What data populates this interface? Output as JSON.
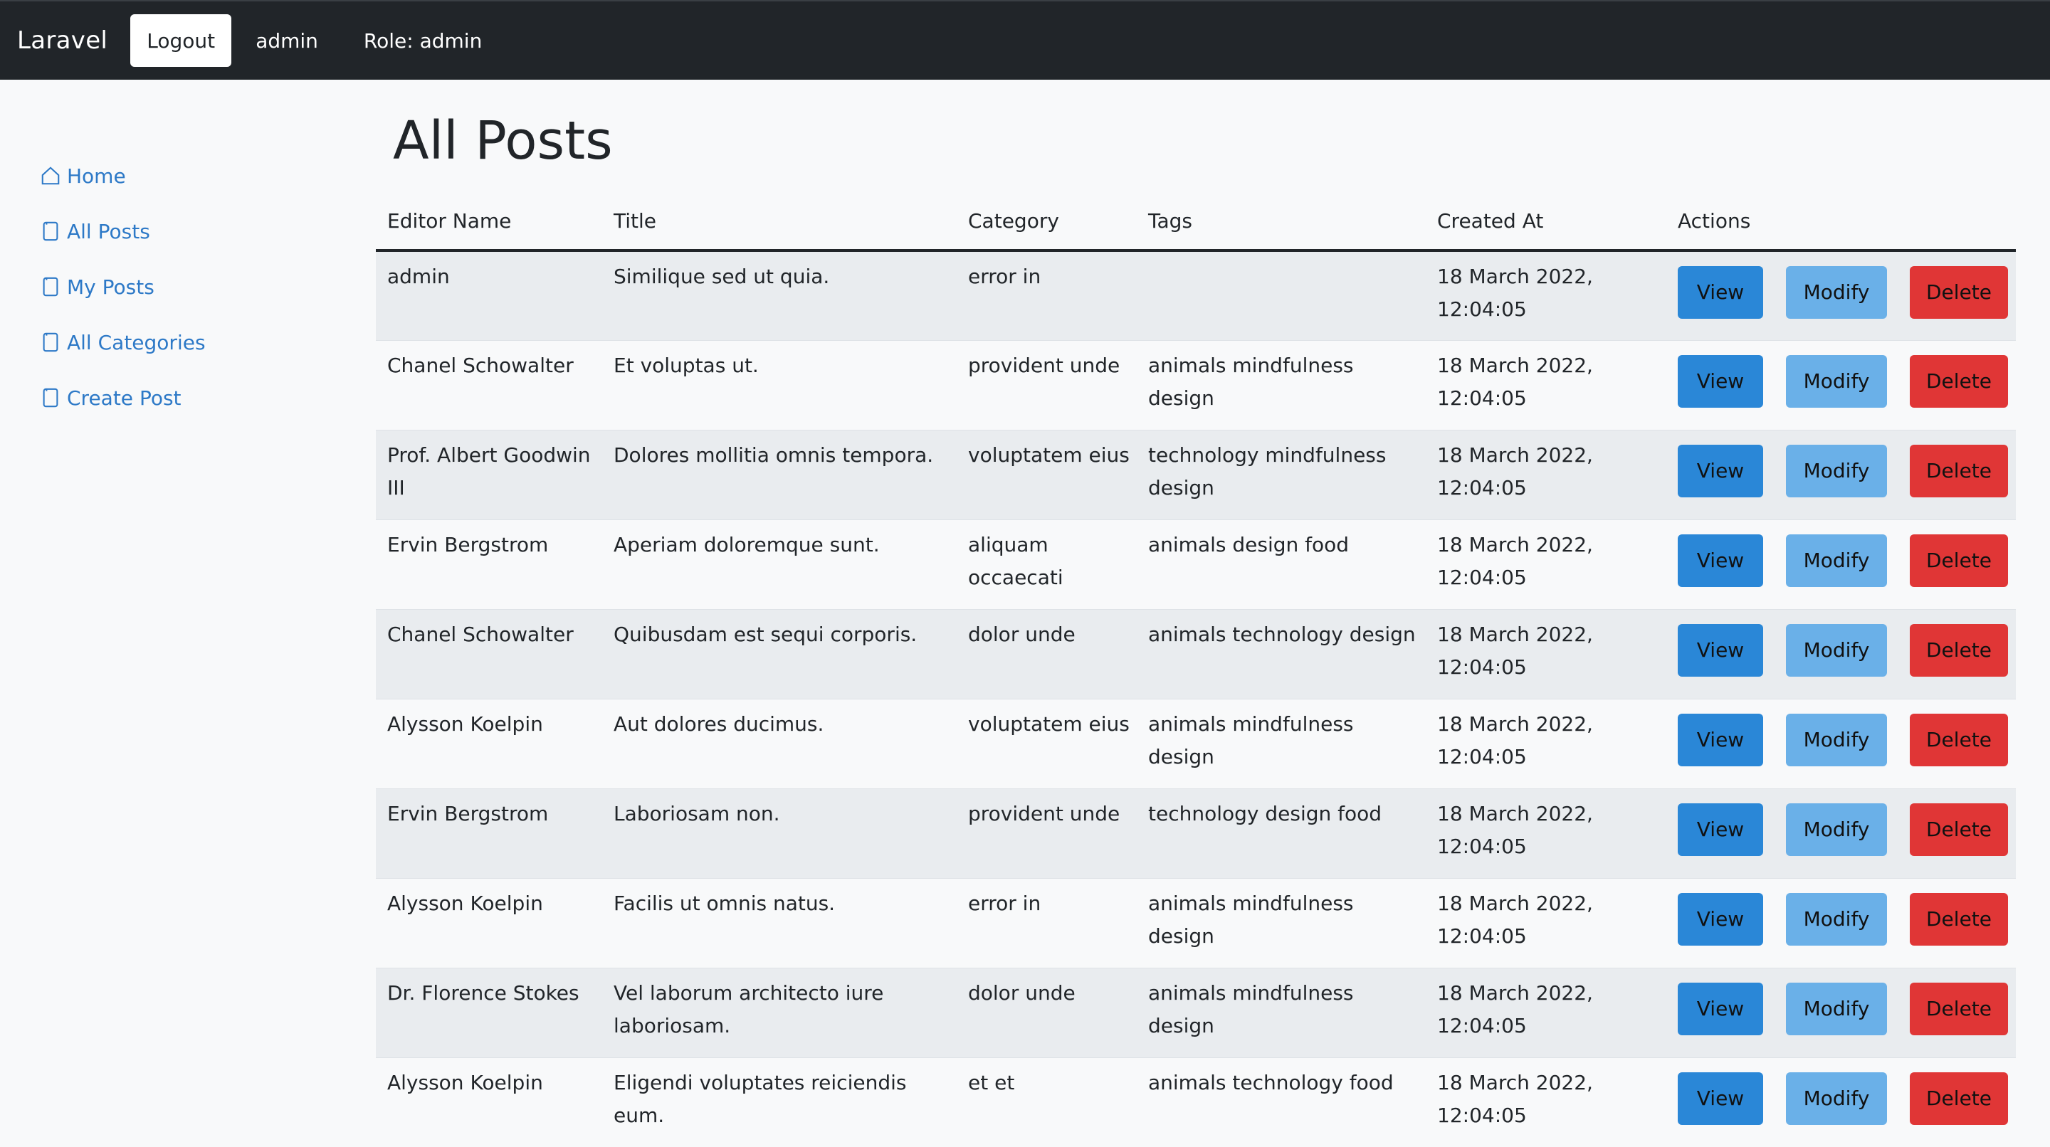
{
  "navbar": {
    "brand": "Laravel",
    "logout_label": "Logout",
    "user": "admin",
    "role": "Role: admin"
  },
  "sidebar": {
    "items": [
      {
        "label": "Home",
        "icon": "house-icon"
      },
      {
        "label": "All Posts",
        "icon": "file-icon"
      },
      {
        "label": "My Posts",
        "icon": "file-icon"
      },
      {
        "label": "All Categories",
        "icon": "file-icon"
      },
      {
        "label": "Create Post",
        "icon": "file-icon"
      }
    ]
  },
  "main": {
    "title": "All Posts",
    "columns": [
      "Editor Name",
      "Title",
      "Category",
      "Tags",
      "Created At",
      "Actions"
    ],
    "action_labels": {
      "view": "View",
      "modify": "Modify",
      "delete": "Delete"
    },
    "rows": [
      {
        "editor": "admin",
        "title": "Similique sed ut quia.",
        "category": "error in",
        "tags": "",
        "created": "18 March 2022, 12:04:05"
      },
      {
        "editor": "Chanel Schowalter",
        "title": "Et voluptas ut.",
        "category": "provident unde",
        "tags": "animals mindfulness design",
        "created": "18 March 2022, 12:04:05"
      },
      {
        "editor": "Prof. Albert Goodwin III",
        "title": "Dolores mollitia omnis tempora.",
        "category": "voluptatem eius",
        "tags": "technology mindfulness design",
        "created": "18 March 2022, 12:04:05"
      },
      {
        "editor": "Ervin Bergstrom",
        "title": "Aperiam doloremque sunt.",
        "category": "aliquam occaecati",
        "tags": "animals design food",
        "created": "18 March 2022, 12:04:05"
      },
      {
        "editor": "Chanel Schowalter",
        "title": "Quibusdam est sequi corporis.",
        "category": "dolor unde",
        "tags": "animals technology design",
        "created": "18 March 2022, 12:04:05"
      },
      {
        "editor": "Alysson Koelpin",
        "title": "Aut dolores ducimus.",
        "category": "voluptatem eius",
        "tags": "animals mindfulness design",
        "created": "18 March 2022, 12:04:05"
      },
      {
        "editor": "Ervin Bergstrom",
        "title": "Laboriosam non.",
        "category": "provident unde",
        "tags": "technology design food",
        "created": "18 March 2022, 12:04:05"
      },
      {
        "editor": "Alysson Koelpin",
        "title": "Facilis ut omnis natus.",
        "category": "error in",
        "tags": "animals mindfulness design",
        "created": "18 March 2022, 12:04:05"
      },
      {
        "editor": "Dr. Florence Stokes",
        "title": "Vel laborum architecto iure laboriosam.",
        "category": "dolor unde",
        "tags": "animals mindfulness design",
        "created": "18 March 2022, 12:04:05"
      },
      {
        "editor": "Alysson Koelpin",
        "title": "Eligendi voluptates reiciendis eum.",
        "category": "et et",
        "tags": "animals technology food",
        "created": "18 March 2022, 12:04:05"
      }
    ]
  },
  "colors": {
    "navbar_bg": "#212529",
    "link": "#2d79c7",
    "view_btn": "#2a87d7",
    "modify_btn": "#6ab0e8",
    "delete_btn": "#e03636",
    "stripe": "#e9ecef"
  }
}
